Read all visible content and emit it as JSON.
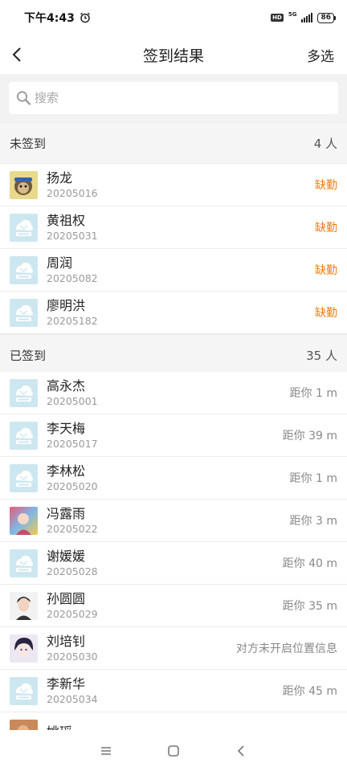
{
  "status_bar": {
    "time": "下午4:43",
    "network": "5G",
    "hd": "HD",
    "battery": "86"
  },
  "header": {
    "title": "签到结果",
    "action": "多选"
  },
  "search": {
    "placeholder": "搜索"
  },
  "absent_section": {
    "title": "未签到",
    "count": "4 人",
    "items": [
      {
        "name": "扬龙",
        "id": "20205016",
        "status": "缺勤",
        "avatar": "photo-monkey"
      },
      {
        "name": "黄祖权",
        "id": "20205031",
        "status": "缺勤",
        "avatar": "default"
      },
      {
        "name": "周润",
        "id": "20205082",
        "status": "缺勤",
        "avatar": "default"
      },
      {
        "name": "廖明洪",
        "id": "20205182",
        "status": "缺勤",
        "avatar": "default"
      }
    ]
  },
  "present_section": {
    "title": "已签到",
    "count": "35 人",
    "items": [
      {
        "name": "高永杰",
        "id": "20205001",
        "status": "距你 1 m",
        "avatar": "default"
      },
      {
        "name": "李天梅",
        "id": "20205017",
        "status": "距你 39 m",
        "avatar": "default"
      },
      {
        "name": "李林松",
        "id": "20205020",
        "status": "距你 1 m",
        "avatar": "default"
      },
      {
        "name": "冯露雨",
        "id": "20205022",
        "status": "距你 3 m",
        "avatar": "photo-colorful"
      },
      {
        "name": "谢媛媛",
        "id": "20205028",
        "status": "距你 40 m",
        "avatar": "default"
      },
      {
        "name": "孙圆圆",
        "id": "20205029",
        "status": "距你 35 m",
        "avatar": "photo-man"
      },
      {
        "name": "刘培钊",
        "id": "20205030",
        "status": "对方未开启位置信息",
        "avatar": "photo-anime"
      },
      {
        "name": "李新华",
        "id": "20205034",
        "status": "距你 45 m",
        "avatar": "default"
      },
      {
        "name": "姚瑶",
        "id": "",
        "status": "",
        "avatar": "photo-warm"
      }
    ]
  },
  "colors": {
    "absent": "#f07c12",
    "default_avatar_bg": "#cde7f0",
    "default_avatar_fg": "#ffffff"
  },
  "bottom_nav": {
    "icons": [
      "menu-icon",
      "home-icon",
      "back-icon"
    ]
  }
}
